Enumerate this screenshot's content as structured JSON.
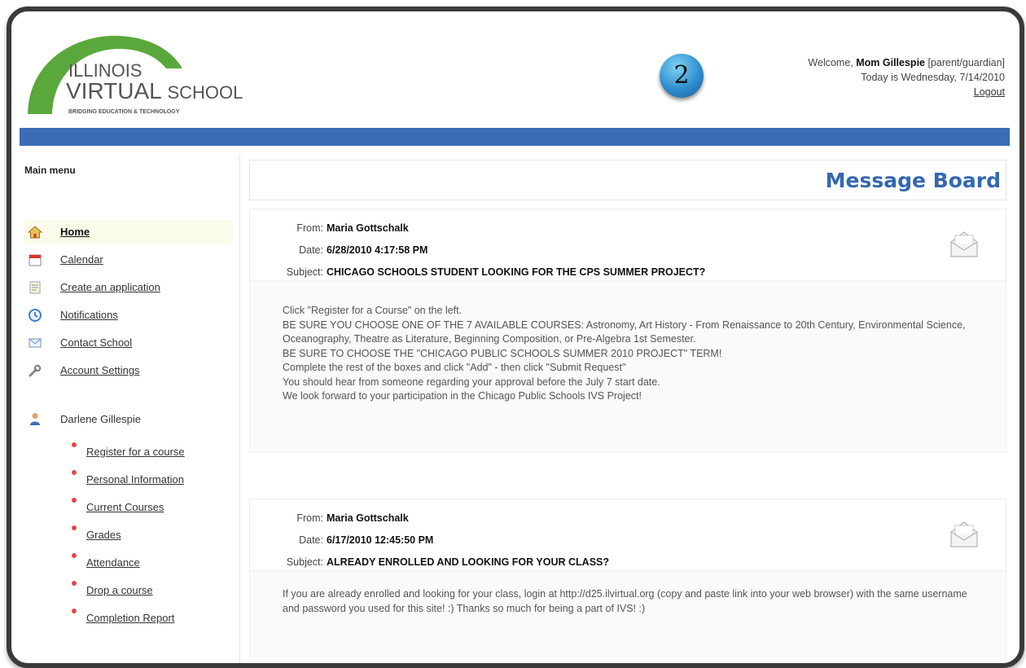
{
  "logo": {
    "line1": "ILLINOIS",
    "line2a": "VIRTUAL",
    "line2b": "SCHOOL",
    "tagline": "BRIDGING EDUCATION & TECHNOLOGY"
  },
  "step_badge": "2",
  "header": {
    "welcome_prefix": "Welcome,",
    "user_name": "Mom Gillespie",
    "user_role": "[parent/guardian]",
    "today": "Today is Wednesday, 7/14/2010",
    "logout": "Logout"
  },
  "sidebar": {
    "title": "Main menu",
    "items": [
      {
        "label": "Home",
        "icon": "home-icon"
      },
      {
        "label": "Calendar",
        "icon": "calendar-icon"
      },
      {
        "label": "Create an application",
        "icon": "application-icon"
      },
      {
        "label": "Notifications",
        "icon": "clock-icon"
      },
      {
        "label": "Contact School",
        "icon": "mail-icon"
      },
      {
        "label": "Account Settings",
        "icon": "wrench-icon"
      }
    ],
    "student_name": "Darlene Gillespie",
    "student_items": [
      {
        "label": "Register for a course"
      },
      {
        "label": "Personal Information"
      },
      {
        "label": "Current Courses"
      },
      {
        "label": "Grades"
      },
      {
        "label": "Attendance"
      },
      {
        "label": "Drop a course"
      },
      {
        "label": "Completion Report"
      }
    ]
  },
  "main": {
    "title": "Message Board",
    "from_label": "From:",
    "date_label": "Date:",
    "subject_label": "Subject:",
    "messages": [
      {
        "from": "Maria Gottschalk",
        "date": "6/28/2010 4:17:58 PM",
        "subject": "CHICAGO SCHOOLS STUDENT LOOKING FOR THE CPS SUMMER PROJECT?",
        "body": "Click \"Register for a Course\" on the left.\nBE SURE YOU CHOOSE ONE OF THE 7 AVAILABLE COURSES: Astronomy, Art History - From Renaissance to 20th Century, Environmental Science, Oceanography, Theatre as Literature, Beginning Composition, or Pre-Algebra 1st Semester.\nBE SURE TO CHOOSE THE \"CHICAGO PUBLIC SCHOOLS SUMMER 2010 PROJECT\" TERM!\nComplete the rest of the boxes and click \"Add\" - then click \"Submit Request\"\nYou should hear from someone regarding your approval before the July 7 start date.\nWe look forward to your participation in the Chicago Public Schools IVS Project!"
      },
      {
        "from": "Maria Gottschalk",
        "date": "6/17/2010 12:45:50 PM",
        "subject": "ALREADY ENROLLED AND LOOKING FOR YOUR CLASS?",
        "body": "If you are already enrolled and looking for your class, login at http://d25.ilvirtual.org (copy and paste link into your web browser) with the same username and password you used for this site! :) Thanks so much for being a part of IVS! :)"
      }
    ]
  },
  "colors": {
    "blue_bar": "#3b6cb5",
    "title_blue": "#3468b0",
    "logo_green": "#5aa83c"
  }
}
